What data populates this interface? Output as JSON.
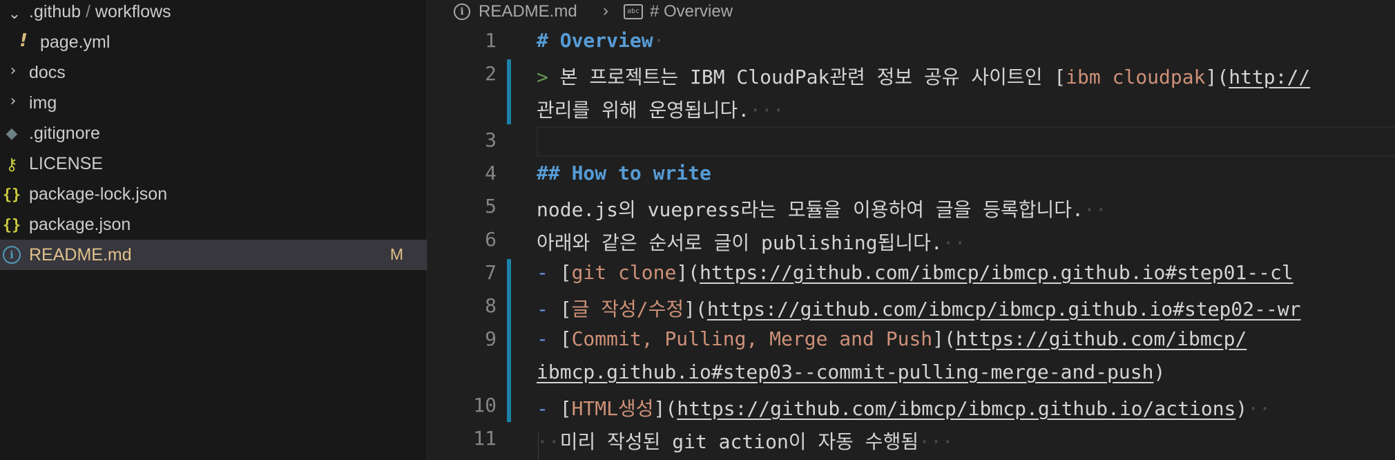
{
  "sidebar": {
    "folder_path": {
      "parent": ".github",
      "sep": "/",
      "child": "workflows"
    },
    "items": [
      {
        "label": "page.yml",
        "icon": "yaml-icon"
      },
      {
        "label": "docs",
        "icon": "chevron-right-icon"
      },
      {
        "label": "img",
        "icon": "chevron-right-icon"
      },
      {
        "label": ".gitignore",
        "icon": "git-icon"
      },
      {
        "label": "LICENSE",
        "icon": "key-icon"
      },
      {
        "label": "package-lock.json",
        "icon": "json-icon"
      },
      {
        "label": "package.json",
        "icon": "json-icon"
      },
      {
        "label": "README.md",
        "icon": "info-icon",
        "badge": "M"
      }
    ]
  },
  "breadcrumb": {
    "file": "README.md",
    "symbol": "# Overview"
  },
  "editor": {
    "line_numbers": [
      "1",
      "2",
      "3",
      "4",
      "5",
      "6",
      "7",
      "8",
      "9",
      "10",
      "11"
    ],
    "l1": {
      "hash": "# ",
      "text": "Overview"
    },
    "l2": {
      "quote": "> ",
      "pre": "본 프로젝트는 IBM CloudPak관련 정보 공유 사이트인 [",
      "link": "ibm cloudpak",
      "mid": "](",
      "url": "http://"
    },
    "l2b": "관리를 위해 운영됩니다.",
    "l4": {
      "hash": "## ",
      "text": "How to write"
    },
    "l5": "node.js의 vuepress라는 모듈을 이용하여 글을 등록합니다.",
    "l6": "아래와 같은 순서로 글이 publishing됩니다.",
    "l7": {
      "bullet": "- ",
      "open": "[",
      "link": "git clone",
      "mid": "](",
      "url": "https://github.com/ibmcp/ibmcp.github.io#step01--cl"
    },
    "l8": {
      "bullet": "- ",
      "open": "[",
      "link": "글 작성/수정",
      "mid": "](",
      "url": "https://github.com/ibmcp/ibmcp.github.io#step02--wr"
    },
    "l9": {
      "bullet": "- ",
      "open": "[",
      "link": "Commit, Pulling, Merge and Push",
      "mid": "](",
      "url": "https://github.com/ibmcp/"
    },
    "l9b": {
      "url": "ibmcp.github.io#step03--commit-pulling-merge-and-push",
      "close": ")"
    },
    "l10": {
      "bullet": "- ",
      "open": "[",
      "link": "HTML생성",
      "mid": "](",
      "url": "https://github.com/ibmcp/ibmcp.github.io/actions",
      "close": ")"
    },
    "l11": "미리 작성된 git action이 자동 수행됨"
  },
  "colors": {
    "heading": "#569cd6",
    "link_text": "#ce9178",
    "quote": "#6a9955",
    "modified_bar": "#1b81a8",
    "modified_file": "#e2c08d"
  }
}
